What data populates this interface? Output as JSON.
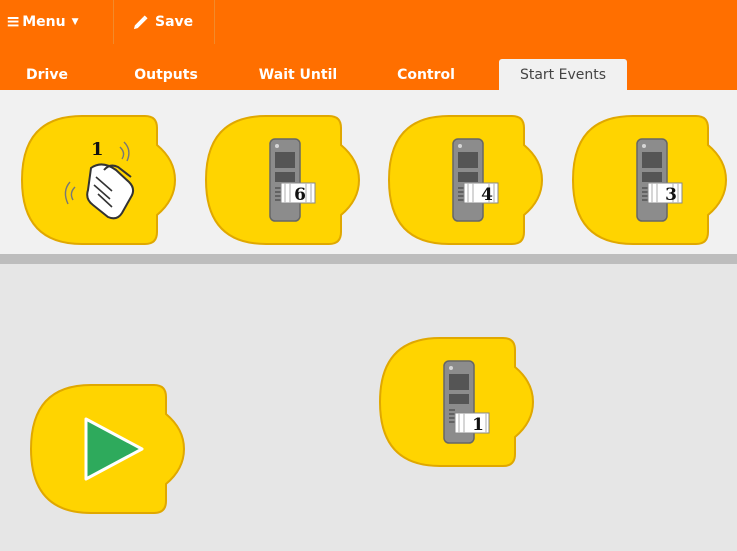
{
  "toolbar": {
    "menu_label": "Menu",
    "save_label": "Save",
    "menu_icon": "hamburger-icon",
    "caret_icon": "caret-down-icon",
    "save_icon": "pencil-icon"
  },
  "tabs": [
    {
      "label": "Drive",
      "active": false
    },
    {
      "label": "Outputs",
      "active": false
    },
    {
      "label": "Wait Until",
      "active": false
    },
    {
      "label": "Control",
      "active": false
    },
    {
      "label": "Start Events",
      "active": true
    }
  ],
  "palette": {
    "blocks": [
      {
        "type": "clap-start",
        "icon": "hand-clap-icon",
        "number": "1"
      },
      {
        "type": "remote-start",
        "icon": "remote-control-icon",
        "number": "6"
      },
      {
        "type": "remote-start",
        "icon": "remote-control-icon",
        "number": "4"
      },
      {
        "type": "remote-start",
        "icon": "remote-control-icon",
        "number": "3"
      }
    ]
  },
  "workspace": {
    "blocks": [
      {
        "type": "green-flag-start",
        "icon": "play-icon"
      },
      {
        "type": "remote-start",
        "icon": "remote-control-icon",
        "number": "1"
      }
    ]
  },
  "colors": {
    "accent_orange": "#ff6f00",
    "block_yellow": "#ffd400",
    "block_stroke": "#e0a800",
    "play_green": "#2eaa5c",
    "palette_bg": "#f1f1f1",
    "workspace_bg": "#e6e6e6",
    "divider": "#bdbdbd"
  }
}
